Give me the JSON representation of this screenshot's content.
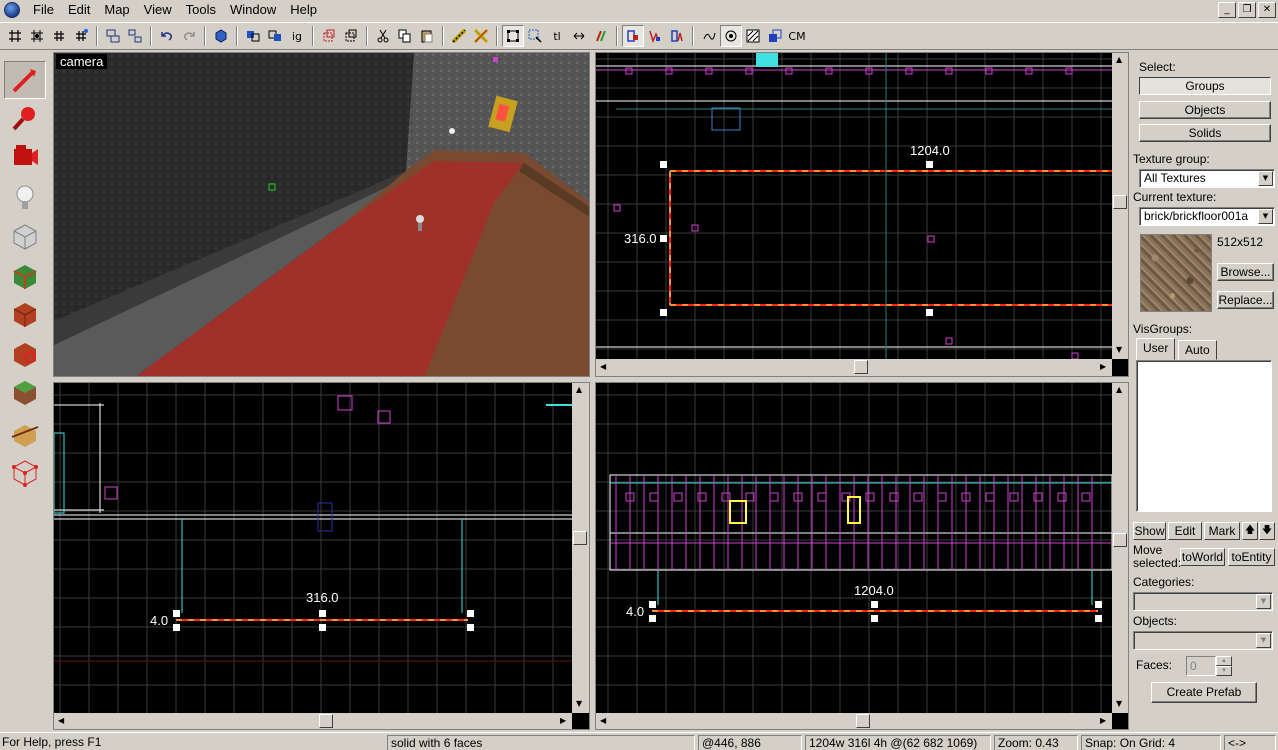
{
  "menu": [
    "File",
    "Edit",
    "Map",
    "View",
    "Tools",
    "Window",
    "Help"
  ],
  "window_buttons": [
    "_",
    "❐",
    "✕"
  ],
  "toolbar": {
    "cm_label": "CM",
    "ig_label": "ig",
    "tl_label": "tl"
  },
  "viewports": {
    "camera": {
      "label": "camera"
    },
    "top": {
      "width_label": "1204.0",
      "height_label": "316.0"
    },
    "side": {
      "width_label": "316.0",
      "height_label": "4.0"
    },
    "front": {
      "width_label": "1204.0",
      "height_label": "4.0"
    }
  },
  "right_panel": {
    "select_label": "Select:",
    "groups_button": "Groups",
    "objects_button": "Objects",
    "solids_button": "Solids",
    "texture_group_label": "Texture group:",
    "texture_group_value": "All Textures",
    "current_texture_label": "Current texture:",
    "current_texture_value": "brick/brickfloor001a",
    "texture_size": "512x512",
    "browse_button": "Browse...",
    "replace_button": "Replace...",
    "visgroups_label": "VisGroups:",
    "tab_user": "User",
    "tab_auto": "Auto",
    "show_button": "Show",
    "edit_button": "Edit",
    "mark_button": "Mark",
    "up_button": "🡅",
    "down_button": "🡇",
    "move_selected_line1": "Move",
    "move_selected_line2": "selected:",
    "to_world_button": "toWorld",
    "to_entity_button": "toEntity",
    "categories_label": "Categories:",
    "objects_label": "Objects:",
    "faces_label": "Faces:",
    "faces_value": "0",
    "create_prefab_button": "Create Prefab"
  },
  "status": {
    "help": "For Help, press F1",
    "selection": "solid with 6 faces",
    "cursor": "@446, 886",
    "size": "1204w 316l 4h @(62 682 1069)",
    "zoom": "Zoom: 0.43",
    "snap": "Snap: On Grid: 4",
    "arrows": "<->"
  },
  "colors": {
    "selection_red": "#ff2020",
    "selection_yellow": "#ffff40",
    "entity_magenta": "#d040d0",
    "brush_cyan": "#40e0e0",
    "grid": "#3a3a3a",
    "grid_major": "#5a5a5a"
  }
}
